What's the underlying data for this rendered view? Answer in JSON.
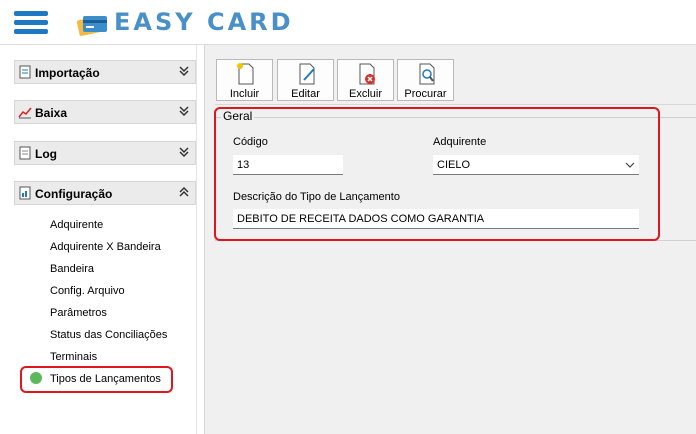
{
  "app": {
    "title": "EASY CARD"
  },
  "sidebar": {
    "sections": [
      {
        "label": "Importação",
        "icon": "import-icon",
        "state": "collapsed"
      },
      {
        "label": "Baixa",
        "icon": "chart-icon",
        "state": "collapsed"
      },
      {
        "label": "Log",
        "icon": "log-icon",
        "state": "collapsed"
      },
      {
        "label": "Configuração",
        "icon": "config-icon",
        "state": "expanded"
      }
    ],
    "items": [
      "Adquirente",
      "Adquirente X Bandeira",
      "Bandeira",
      "Config. Arquivo",
      "Parâmetros",
      "Status das Conciliações",
      "Terminais",
      "Tipos de Lançamentos"
    ],
    "selected": "Tipos de Lançamentos"
  },
  "toolbar": {
    "incluir": "Incluir",
    "editar": "Editar",
    "excluir": "Excluir",
    "procurar": "Procurar"
  },
  "form": {
    "group": "Geral",
    "codigo_label": "Código",
    "codigo_value": "13",
    "adquirente_label": "Adquirente",
    "adquirente_value": "CIELO",
    "descricao_label": "Descrição do Tipo de Lançamento",
    "descricao_value": "DEBITO DE RECEITA DADOS COMO GARANTIA"
  },
  "colors": {
    "accent": "#1e78c2",
    "highlight": "#e0161d",
    "logo": "#4a90c8"
  }
}
